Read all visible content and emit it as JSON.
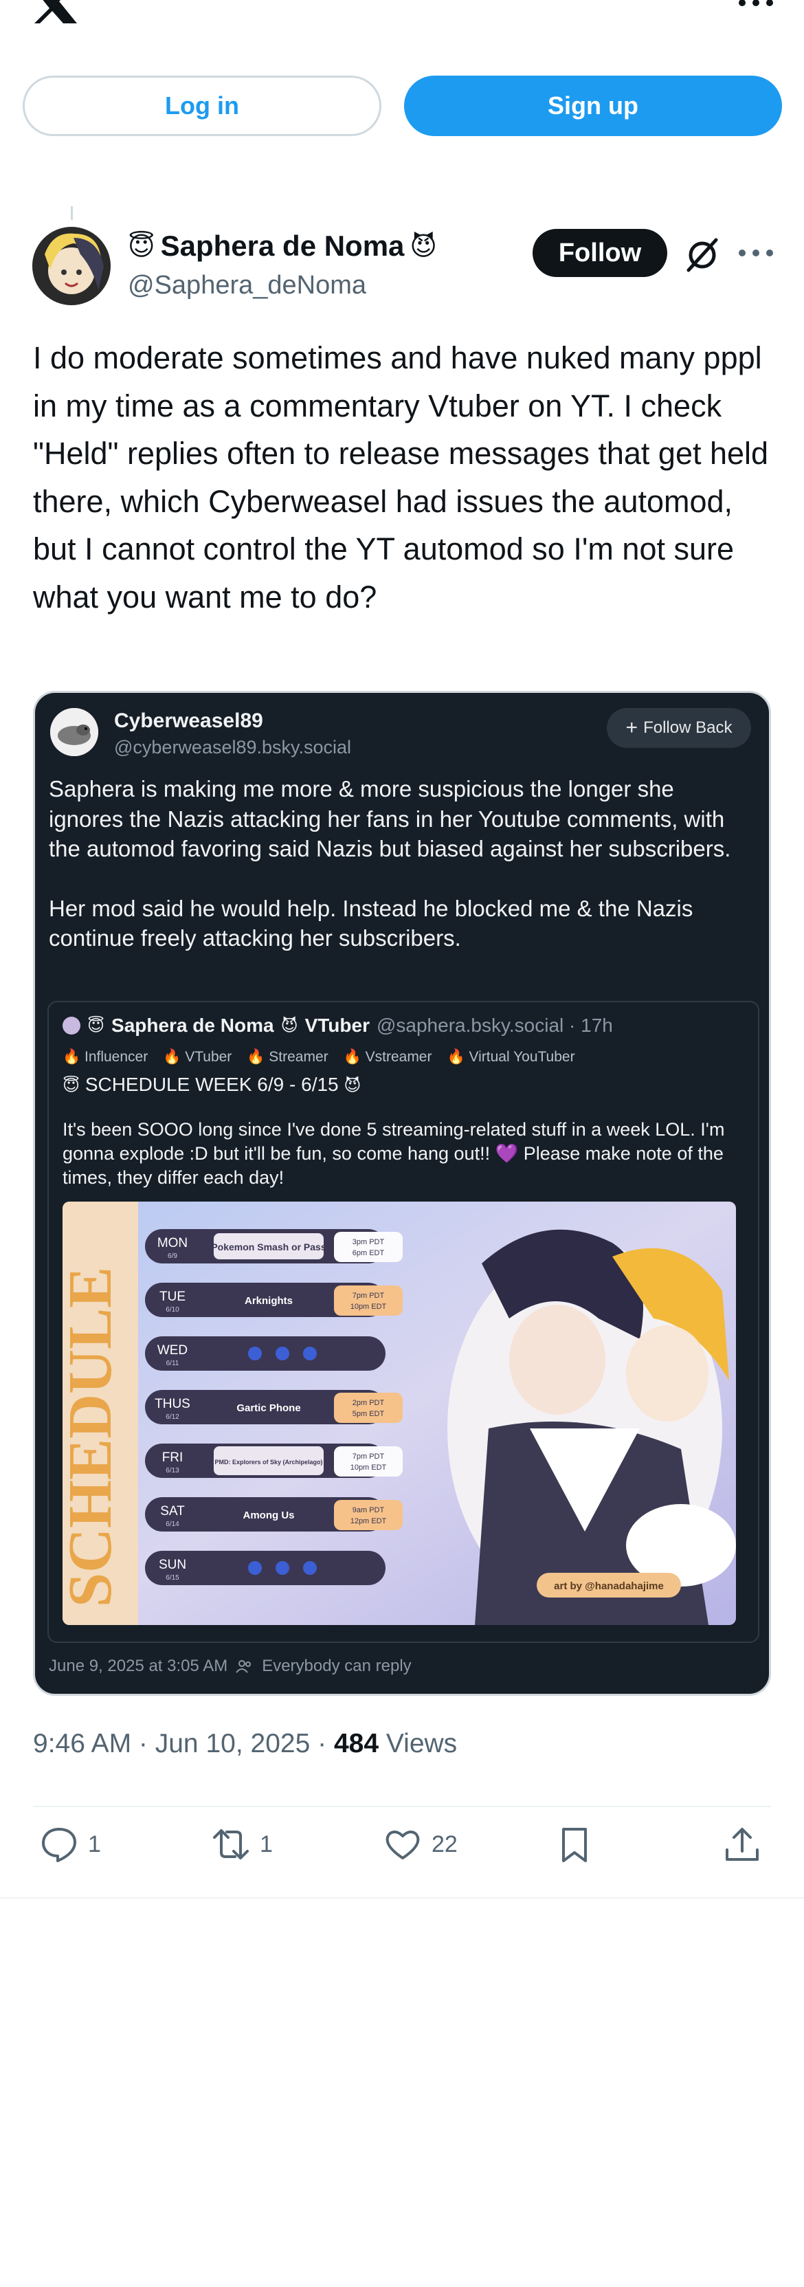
{
  "top_bar": {
    "login_label": "Log in",
    "signup_label": "Sign up"
  },
  "post": {
    "display_name": "Saphera de Noma",
    "name_prefix_emoji": "😇",
    "name_suffix_emoji": "😈",
    "handle": "@Saphera_deNoma",
    "follow_label": "Follow",
    "text": "I do moderate sometimes and have nuked many pppl in my time as a commentary Vtuber on YT.  I check \"Held\" replies often to release messages that get held there, which Cyberweasel had issues the automod, but I cannot control the YT automod so I'm not sure what you want me to do?",
    "time": "9:46 AM · Jun 10, 2025 · ",
    "views_count": "484",
    "views_label": " Views"
  },
  "embed": {
    "name": "Cyberweasel89",
    "handle": "@cyberweasel89.bsky.social",
    "follow_back_label": "Follow Back",
    "text_1": "Saphera is making me more & more suspicious the longer she ignores the Nazis attacking her fans in her Youtube comments, with the automod favoring said Nazis but biased against her subscribers.",
    "text_2": "Her mod said he would help. Instead he blocked me & the Nazis continue freely attacking her subscribers.",
    "quote": {
      "name": "Saphera de Noma",
      "name_suffix": "VTuber",
      "handle_time": "@saphera.bsky.social · 17h",
      "tags": [
        "Influencer",
        "VTuber",
        "Streamer",
        "Vstreamer",
        "Virtual YouTuber"
      ],
      "schedule_title": "SCHEDULE WEEK 6/9 - 6/15",
      "body": "It's been SOOO long since I've done 5 streaming-related stuff in a week LOL. I'm gonna explode :D but it'll be fun, so come hang out!! 💜 Please make note of the times, they differ each day!",
      "schedule_days": [
        {
          "day": "MON",
          "date": "6/9",
          "title": "Pokemon Smash or Pass",
          "time1": "3pm PDT",
          "time2": "6pm EDT"
        },
        {
          "day": "TUE",
          "date": "6/10",
          "title": "Arknights",
          "time1": "7pm PDT",
          "time2": "10pm EDT"
        },
        {
          "day": "WED",
          "date": "6/11",
          "title": "",
          "time1": "",
          "time2": ""
        },
        {
          "day": "THUS",
          "date": "6/12",
          "title": "Gartic Phone",
          "time1": "2pm PDT",
          "time2": "5pm EDT"
        },
        {
          "day": "FRI",
          "date": "6/13",
          "title": "PMD: Explorers of Sky (Archipelago)",
          "time1": "7pm PDT",
          "time2": "10pm EDT"
        },
        {
          "day": "SAT",
          "date": "6/14",
          "title": "Among Us",
          "time1": "9am PDT",
          "time2": "12pm EDT"
        },
        {
          "day": "SUN",
          "date": "6/15",
          "title": "",
          "time1": "",
          "time2": ""
        }
      ],
      "art_credit": "art by @hanadahajime",
      "side_text": "SCHEDULE"
    },
    "footer_date": "June 9, 2025 at 3:05 AM",
    "footer_reply": "Everybody can reply"
  },
  "actions": {
    "replies": "1",
    "reposts": "1",
    "likes": "22"
  }
}
